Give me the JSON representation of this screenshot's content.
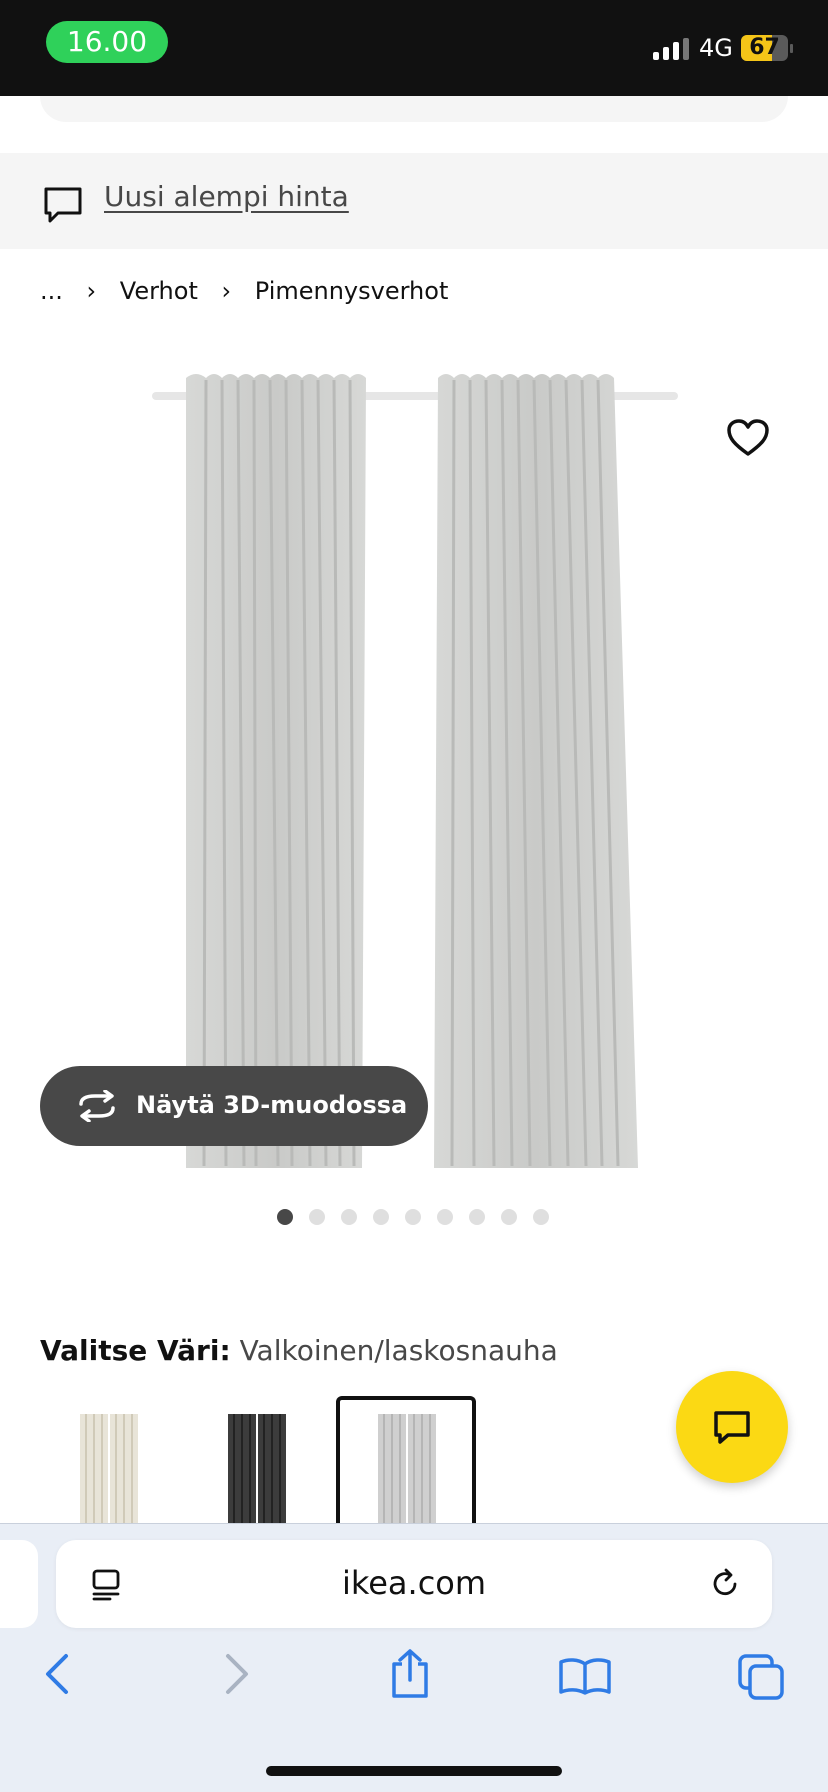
{
  "status_bar": {
    "time": "16.00",
    "network": "4G",
    "battery": "67",
    "battery_level": 0.67
  },
  "promo": {
    "link": "Uusi alempi hinta"
  },
  "breadcrumb": {
    "ellipsis": "...",
    "items": [
      "Verhot",
      "Pimennysverhot"
    ]
  },
  "product": {
    "image_icon": "curtains-image",
    "view_3d_label": "Näytä 3D-muodossa"
  },
  "carousel": {
    "total": 9,
    "active_index": 0
  },
  "color_selector": {
    "label": "Valitse Väri:",
    "value": "Valkoinen/laskosnauha",
    "swatches": [
      {
        "color": "#e8e4d8",
        "selected": false
      },
      {
        "color": "#3c3c3c",
        "selected": false
      },
      {
        "color": "#cfcfcf",
        "selected": true
      }
    ]
  },
  "colors": {
    "chat_button": "#fbd914",
    "time_pill": "#2fd15a",
    "accent_blue": "#2f7be5"
  },
  "browser": {
    "url": "ikea.com"
  }
}
